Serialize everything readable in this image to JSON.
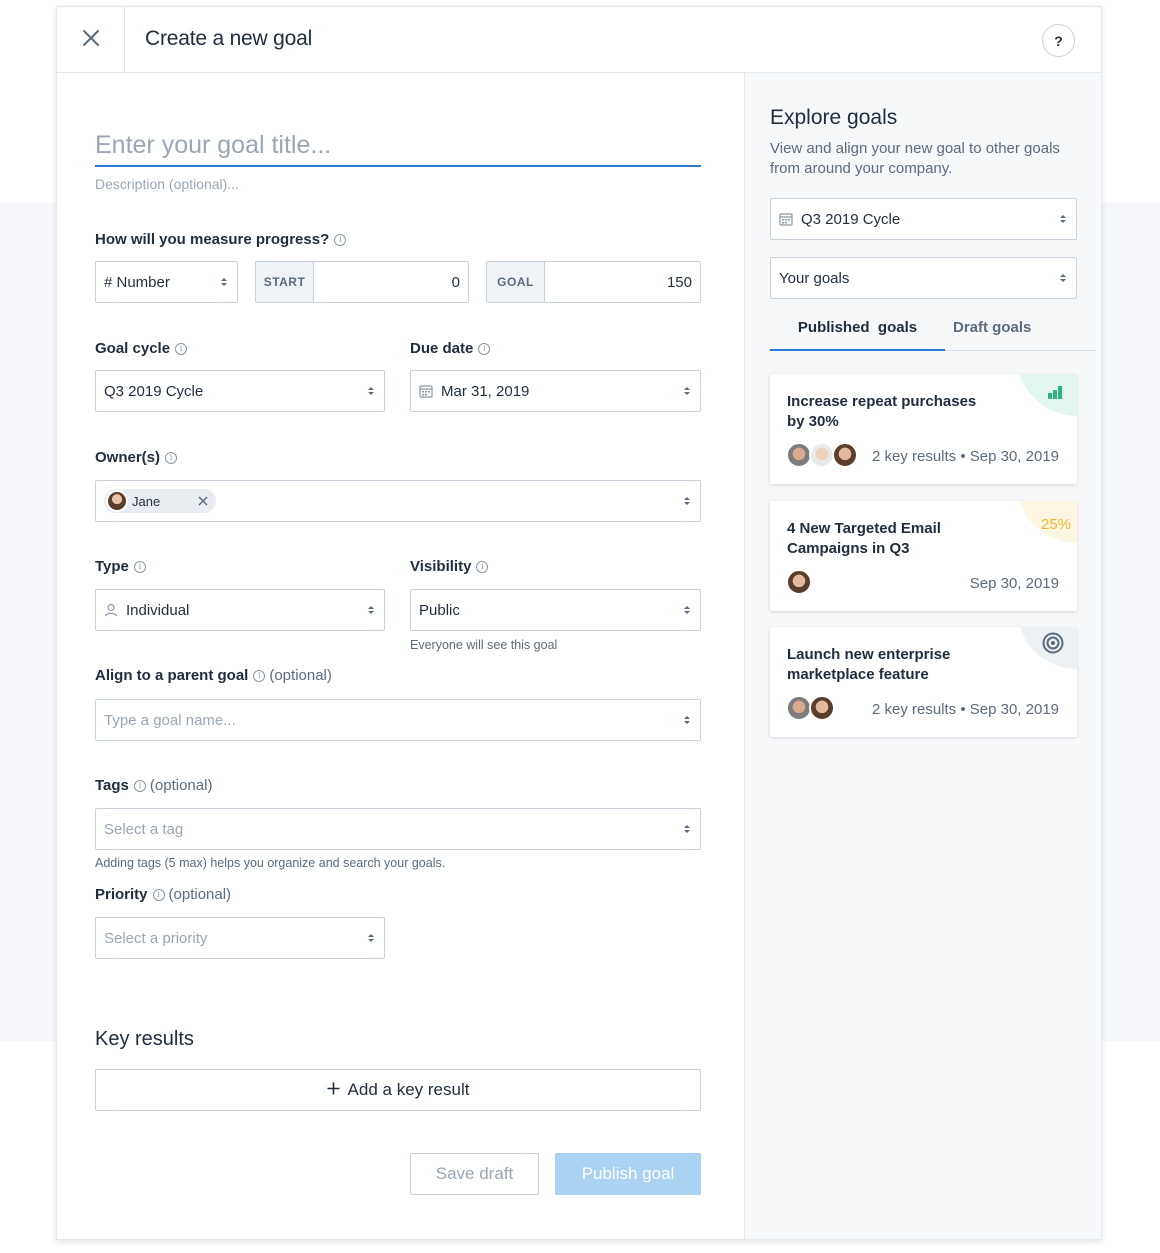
{
  "header": {
    "title": "Create a new goal",
    "help_label": "?"
  },
  "form": {
    "title_placeholder": "Enter your goal title...",
    "description_placeholder": "Description (optional)...",
    "measure": {
      "label": "How will you measure progress?",
      "type_value": "# Number",
      "start_tag": "START",
      "start_value": "0",
      "goal_tag": "GOAL",
      "goal_value": "150"
    },
    "goal_cycle": {
      "label": "Goal cycle",
      "value": "Q3 2019 Cycle"
    },
    "due_date": {
      "label": "Due date",
      "value": "Mar 31, 2019"
    },
    "owners": {
      "label": "Owner(s)",
      "chip_name": "Jane"
    },
    "type": {
      "label": "Type",
      "value": "Individual"
    },
    "visibility": {
      "label": "Visibility",
      "value": "Public",
      "hint": "Everyone will see this goal"
    },
    "parent_goal": {
      "label": "Align to a parent goal",
      "optional": "(optional)",
      "placeholder": "Type a goal name..."
    },
    "tags": {
      "label": "Tags",
      "optional": "(optional)",
      "placeholder": "Select a tag",
      "hint": "Adding tags (5 max) helps you organize and search your goals."
    },
    "priority": {
      "label": "Priority",
      "optional": "(optional)",
      "placeholder": "Select a priority"
    },
    "key_results": {
      "title": "Key results",
      "add_label": "Add a key result"
    },
    "buttons": {
      "save_draft": "Save draft",
      "publish": "Publish goal"
    }
  },
  "explore": {
    "title": "Explore goals",
    "description": "View and align your new goal to other goals from around your company.",
    "cycle_select": "Q3 2019 Cycle",
    "scope_select": "Your goals",
    "tabs": [
      {
        "label": "Published  goals",
        "active": true
      },
      {
        "label": "Draft goals",
        "active": false
      }
    ],
    "cards": [
      {
        "title": "Increase repeat purchases by 30%",
        "meta": "2 key results • Sep 30, 2019",
        "badge_icon": "bar-chart-icon",
        "badge_color": "#e3f5ef",
        "icon_color": "#2bb38a"
      },
      {
        "title": "4 New Targeted Email Campaigns in Q3",
        "meta": "Sep 30, 2019",
        "badge_text": "25%",
        "badge_color": "#fdf6e3",
        "text_color": "#f2b632"
      },
      {
        "title": "Launch new enterprise marketplace feature",
        "meta": "2 key results • Sep 30, 2019",
        "badge_icon": "target-icon",
        "badge_color": "#eef1f4",
        "icon_color": "#5b6b7c"
      }
    ]
  },
  "colors": {
    "accent": "#2d7ad6",
    "publish_disabled": "#a9d2f3",
    "text": "#1f2d3d",
    "muted": "#5b6b7c"
  }
}
